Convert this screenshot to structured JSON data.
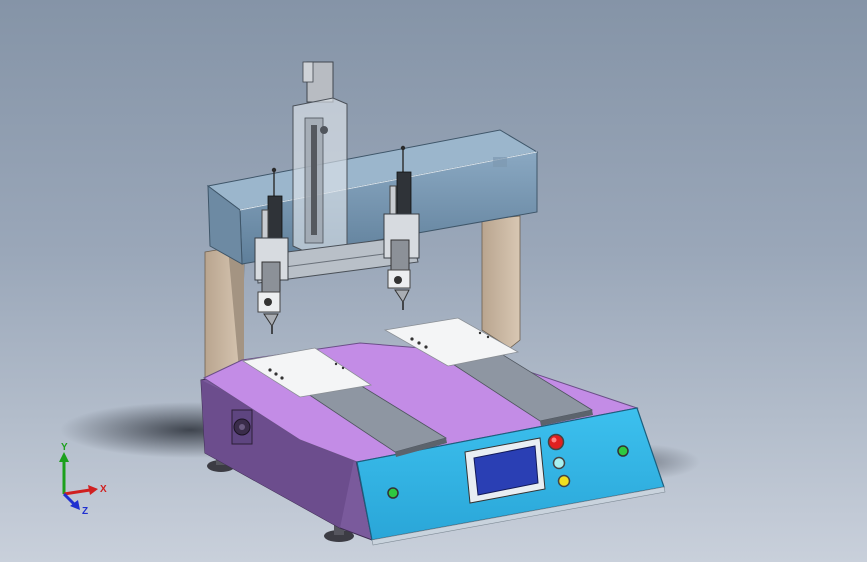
{
  "viewport": {
    "background_top": "#8594a7",
    "background_bottom": "#c9d0db"
  },
  "model": {
    "base_color": "#7a5a9c",
    "table_color": "#c38ce6",
    "front_panel_color": "#35b4e6",
    "gantry_color": "#6f8ea8",
    "column_color": "#c9b59f",
    "screen_color": "#2a3fb4",
    "buttons": [
      {
        "name": "red-button",
        "color": "#e02020"
      },
      {
        "name": "cyan-button",
        "color": "#a8f0f0"
      },
      {
        "name": "yellow-button",
        "color": "#f0e020"
      },
      {
        "name": "left-green-indicator",
        "color": "#2ec840"
      },
      {
        "name": "right-green-indicator",
        "color": "#2ec840"
      }
    ]
  },
  "triad": {
    "y_label": "Y",
    "x_label": "X",
    "z_label": "Z",
    "y_color": "#1ca01c",
    "x_color": "#d02020",
    "z_color": "#2030d0"
  }
}
